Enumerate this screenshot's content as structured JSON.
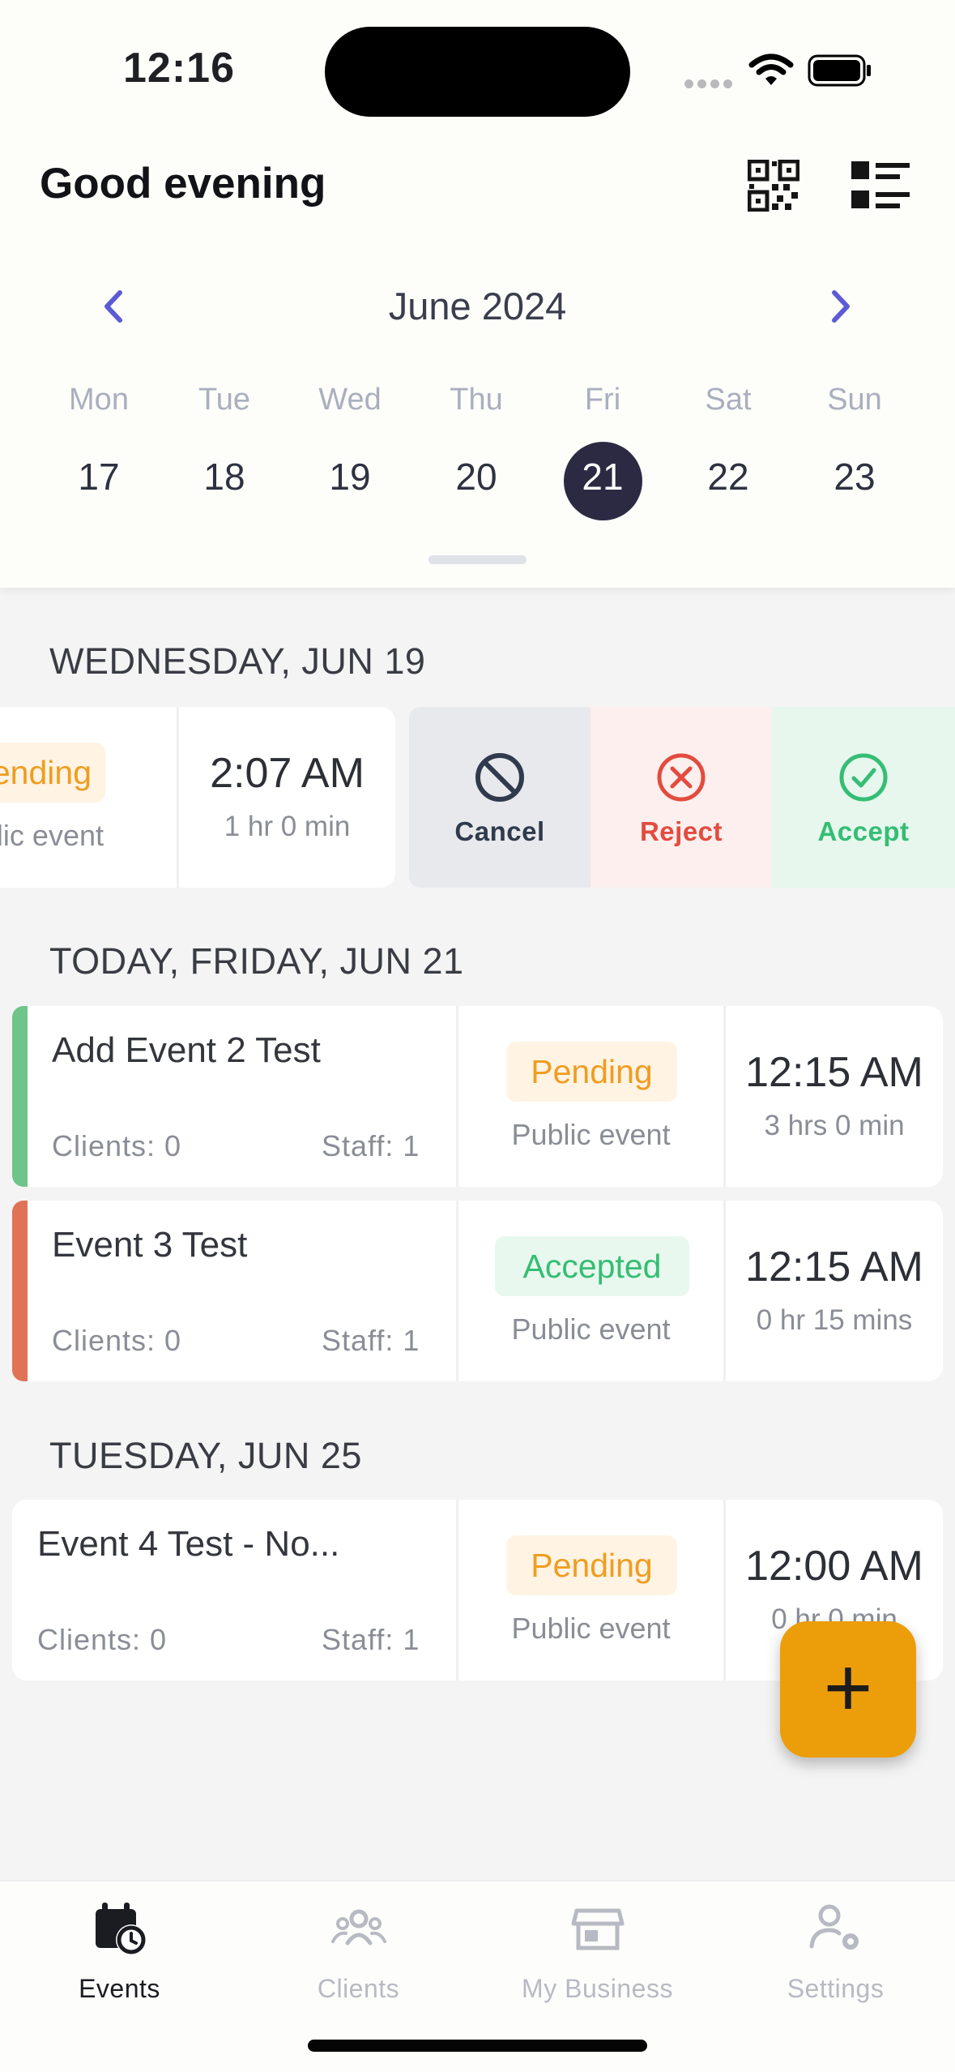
{
  "status_bar": {
    "time": "12:16"
  },
  "header": {
    "greeting": "Good evening"
  },
  "calendar": {
    "month": "June 2024",
    "weekdays": [
      "Mon",
      "Tue",
      "Wed",
      "Thu",
      "Fri",
      "Sat",
      "Sun"
    ],
    "days": [
      "17",
      "18",
      "19",
      "20",
      "21",
      "22",
      "23"
    ],
    "selected_day": "21"
  },
  "sections": [
    {
      "header": "WEDNESDAY, JUN 19",
      "events": [
        {
          "status": "Pending",
          "type": "Public event",
          "time": "2:07 AM",
          "duration": "1 hr 0 min"
        }
      ],
      "swipe_actions": {
        "cancel": "Cancel",
        "reject": "Reject",
        "accept": "Accept"
      }
    },
    {
      "header": "TODAY, FRIDAY, JUN 21",
      "events": [
        {
          "title": "Add Event 2 Test",
          "clients": "Clients: 0",
          "staff": "Staff: 1",
          "status": "Pending",
          "type": "Public event",
          "time": "12:15 AM",
          "duration": "3 hrs 0 min"
        },
        {
          "title": "Event 3 Test",
          "clients": "Clients: 0",
          "staff": "Staff: 1",
          "status": "Accepted",
          "type": "Public event",
          "time": "12:15 AM",
          "duration": "0 hr 15 mins"
        }
      ]
    },
    {
      "header": "TUESDAY, JUN 25",
      "events": [
        {
          "title": "Event 4 Test - No...",
          "clients": "Clients: 0",
          "staff": "Staff: 1",
          "status": "Pending",
          "type": "Public event",
          "time": "12:00 AM",
          "duration": "0 hr 0 min"
        }
      ]
    }
  ],
  "fab": {
    "label": "+"
  },
  "tabs": [
    {
      "label": "Events",
      "icon": "calendar-clock-icon"
    },
    {
      "label": "Clients",
      "icon": "users-icon"
    },
    {
      "label": "My Business",
      "icon": "store-icon"
    },
    {
      "label": "Settings",
      "icon": "user-gear-icon"
    }
  ],
  "colors": {
    "accent": "#5b5bd6",
    "selected_day": "#2c2a42",
    "pending": "#ef9d20",
    "accepted": "#35bd74",
    "reject": "#e24c3f",
    "fab": "#ec9d0a"
  }
}
